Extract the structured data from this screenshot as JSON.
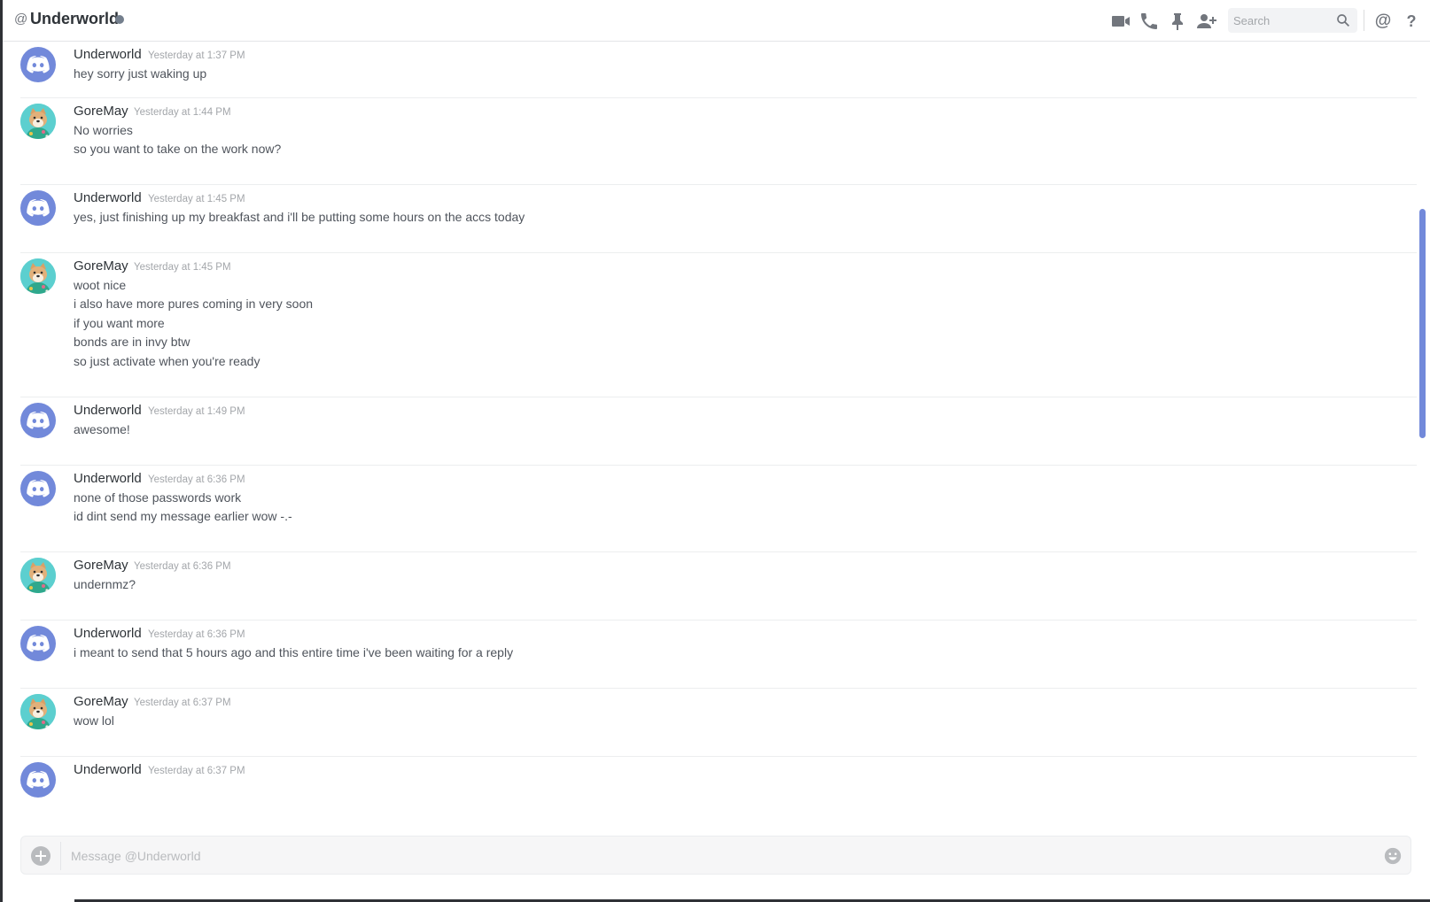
{
  "header": {
    "at_symbol": "@",
    "title": "Underworld",
    "search_placeholder": "Search",
    "icons": [
      "video-call-icon",
      "voice-call-icon",
      "pin-icon",
      "add-friend-icon",
      "search-icon",
      "mentions-icon",
      "help-icon"
    ],
    "mentions_glyph": "@",
    "help_glyph": "?"
  },
  "colors": {
    "accent": "#7289da",
    "avatar_dog_bg": "#5ccfcf",
    "status_offline": "#747f8d"
  },
  "messages": [
    {
      "author": "Underworld",
      "avatar": "discord",
      "timestamp": "Yesterday at 1:37 PM",
      "lines": [
        "hey sorry just waking up"
      ]
    },
    {
      "author": "GoreMay",
      "avatar": "dog",
      "timestamp": "Yesterday at 1:44 PM",
      "lines": [
        "No worries",
        "so you want to take on the work now?"
      ]
    },
    {
      "author": "Underworld",
      "avatar": "discord",
      "timestamp": "Yesterday at 1:45 PM",
      "lines": [
        "yes, just finishing up my breakfast and i'll be putting some hours on the accs today"
      ]
    },
    {
      "author": "GoreMay",
      "avatar": "dog",
      "timestamp": "Yesterday at 1:45 PM",
      "lines": [
        "woot nice",
        "i also have more pures coming in very soon",
        "if you want more",
        "bonds are in invy btw",
        "so just activate when you're ready"
      ]
    },
    {
      "author": "Underworld",
      "avatar": "discord",
      "timestamp": "Yesterday at 1:49 PM",
      "lines": [
        "awesome!"
      ]
    },
    {
      "author": "Underworld",
      "avatar": "discord",
      "timestamp": "Yesterday at 6:36 PM",
      "lines": [
        "none of those passwords work",
        "id dint send my message earlier wow -.-"
      ]
    },
    {
      "author": "GoreMay",
      "avatar": "dog",
      "timestamp": "Yesterday at 6:36 PM",
      "lines": [
        "undernmz?"
      ]
    },
    {
      "author": "Underworld",
      "avatar": "discord",
      "timestamp": "Yesterday at 6:36 PM",
      "lines": [
        "i meant to send that 5 hours ago and this entire time i've been waiting for a reply"
      ]
    },
    {
      "author": "GoreMay",
      "avatar": "dog",
      "timestamp": "Yesterday at 6:37 PM",
      "lines": [
        "wow lol"
      ]
    },
    {
      "author": "Underworld",
      "avatar": "discord",
      "timestamp": "Yesterday at 6:37 PM",
      "lines": []
    }
  ],
  "composer": {
    "placeholder": "Message @Underworld",
    "value": ""
  }
}
